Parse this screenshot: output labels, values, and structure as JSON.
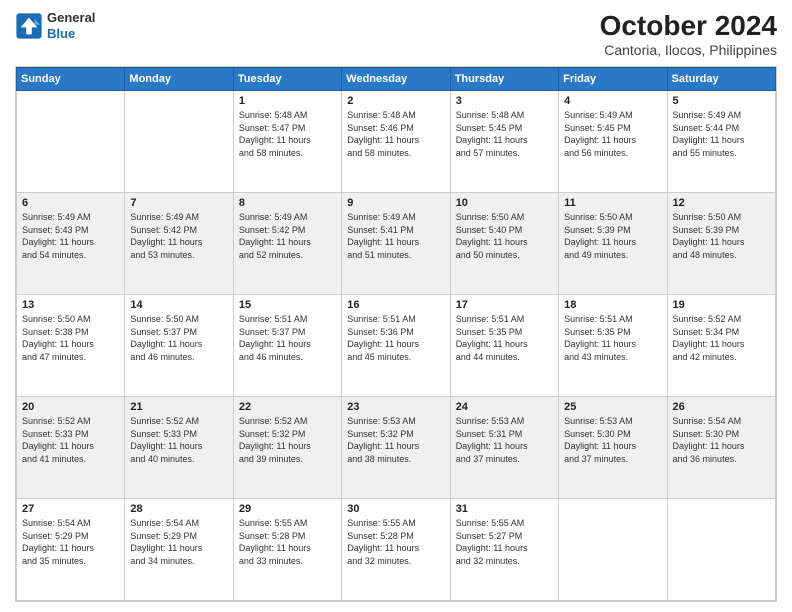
{
  "logo": {
    "line1": "General",
    "line2": "Blue"
  },
  "title": "October 2024",
  "subtitle": "Cantoria, Ilocos, Philippines",
  "weekdays": [
    "Sunday",
    "Monday",
    "Tuesday",
    "Wednesday",
    "Thursday",
    "Friday",
    "Saturday"
  ],
  "weeks": [
    [
      {
        "day": "",
        "info": ""
      },
      {
        "day": "",
        "info": ""
      },
      {
        "day": "1",
        "info": "Sunrise: 5:48 AM\nSunset: 5:47 PM\nDaylight: 11 hours\nand 58 minutes."
      },
      {
        "day": "2",
        "info": "Sunrise: 5:48 AM\nSunset: 5:46 PM\nDaylight: 11 hours\nand 58 minutes."
      },
      {
        "day": "3",
        "info": "Sunrise: 5:48 AM\nSunset: 5:45 PM\nDaylight: 11 hours\nand 57 minutes."
      },
      {
        "day": "4",
        "info": "Sunrise: 5:49 AM\nSunset: 5:45 PM\nDaylight: 11 hours\nand 56 minutes."
      },
      {
        "day": "5",
        "info": "Sunrise: 5:49 AM\nSunset: 5:44 PM\nDaylight: 11 hours\nand 55 minutes."
      }
    ],
    [
      {
        "day": "6",
        "info": "Sunrise: 5:49 AM\nSunset: 5:43 PM\nDaylight: 11 hours\nand 54 minutes."
      },
      {
        "day": "7",
        "info": "Sunrise: 5:49 AM\nSunset: 5:42 PM\nDaylight: 11 hours\nand 53 minutes."
      },
      {
        "day": "8",
        "info": "Sunrise: 5:49 AM\nSunset: 5:42 PM\nDaylight: 11 hours\nand 52 minutes."
      },
      {
        "day": "9",
        "info": "Sunrise: 5:49 AM\nSunset: 5:41 PM\nDaylight: 11 hours\nand 51 minutes."
      },
      {
        "day": "10",
        "info": "Sunrise: 5:50 AM\nSunset: 5:40 PM\nDaylight: 11 hours\nand 50 minutes."
      },
      {
        "day": "11",
        "info": "Sunrise: 5:50 AM\nSunset: 5:39 PM\nDaylight: 11 hours\nand 49 minutes."
      },
      {
        "day": "12",
        "info": "Sunrise: 5:50 AM\nSunset: 5:39 PM\nDaylight: 11 hours\nand 48 minutes."
      }
    ],
    [
      {
        "day": "13",
        "info": "Sunrise: 5:50 AM\nSunset: 5:38 PM\nDaylight: 11 hours\nand 47 minutes."
      },
      {
        "day": "14",
        "info": "Sunrise: 5:50 AM\nSunset: 5:37 PM\nDaylight: 11 hours\nand 46 minutes."
      },
      {
        "day": "15",
        "info": "Sunrise: 5:51 AM\nSunset: 5:37 PM\nDaylight: 11 hours\nand 46 minutes."
      },
      {
        "day": "16",
        "info": "Sunrise: 5:51 AM\nSunset: 5:36 PM\nDaylight: 11 hours\nand 45 minutes."
      },
      {
        "day": "17",
        "info": "Sunrise: 5:51 AM\nSunset: 5:35 PM\nDaylight: 11 hours\nand 44 minutes."
      },
      {
        "day": "18",
        "info": "Sunrise: 5:51 AM\nSunset: 5:35 PM\nDaylight: 11 hours\nand 43 minutes."
      },
      {
        "day": "19",
        "info": "Sunrise: 5:52 AM\nSunset: 5:34 PM\nDaylight: 11 hours\nand 42 minutes."
      }
    ],
    [
      {
        "day": "20",
        "info": "Sunrise: 5:52 AM\nSunset: 5:33 PM\nDaylight: 11 hours\nand 41 minutes."
      },
      {
        "day": "21",
        "info": "Sunrise: 5:52 AM\nSunset: 5:33 PM\nDaylight: 11 hours\nand 40 minutes."
      },
      {
        "day": "22",
        "info": "Sunrise: 5:52 AM\nSunset: 5:32 PM\nDaylight: 11 hours\nand 39 minutes."
      },
      {
        "day": "23",
        "info": "Sunrise: 5:53 AM\nSunset: 5:32 PM\nDaylight: 11 hours\nand 38 minutes."
      },
      {
        "day": "24",
        "info": "Sunrise: 5:53 AM\nSunset: 5:31 PM\nDaylight: 11 hours\nand 37 minutes."
      },
      {
        "day": "25",
        "info": "Sunrise: 5:53 AM\nSunset: 5:30 PM\nDaylight: 11 hours\nand 37 minutes."
      },
      {
        "day": "26",
        "info": "Sunrise: 5:54 AM\nSunset: 5:30 PM\nDaylight: 11 hours\nand 36 minutes."
      }
    ],
    [
      {
        "day": "27",
        "info": "Sunrise: 5:54 AM\nSunset: 5:29 PM\nDaylight: 11 hours\nand 35 minutes."
      },
      {
        "day": "28",
        "info": "Sunrise: 5:54 AM\nSunset: 5:29 PM\nDaylight: 11 hours\nand 34 minutes."
      },
      {
        "day": "29",
        "info": "Sunrise: 5:55 AM\nSunset: 5:28 PM\nDaylight: 11 hours\nand 33 minutes."
      },
      {
        "day": "30",
        "info": "Sunrise: 5:55 AM\nSunset: 5:28 PM\nDaylight: 11 hours\nand 32 minutes."
      },
      {
        "day": "31",
        "info": "Sunrise: 5:55 AM\nSunset: 5:27 PM\nDaylight: 11 hours\nand 32 minutes."
      },
      {
        "day": "",
        "info": ""
      },
      {
        "day": "",
        "info": ""
      }
    ]
  ]
}
